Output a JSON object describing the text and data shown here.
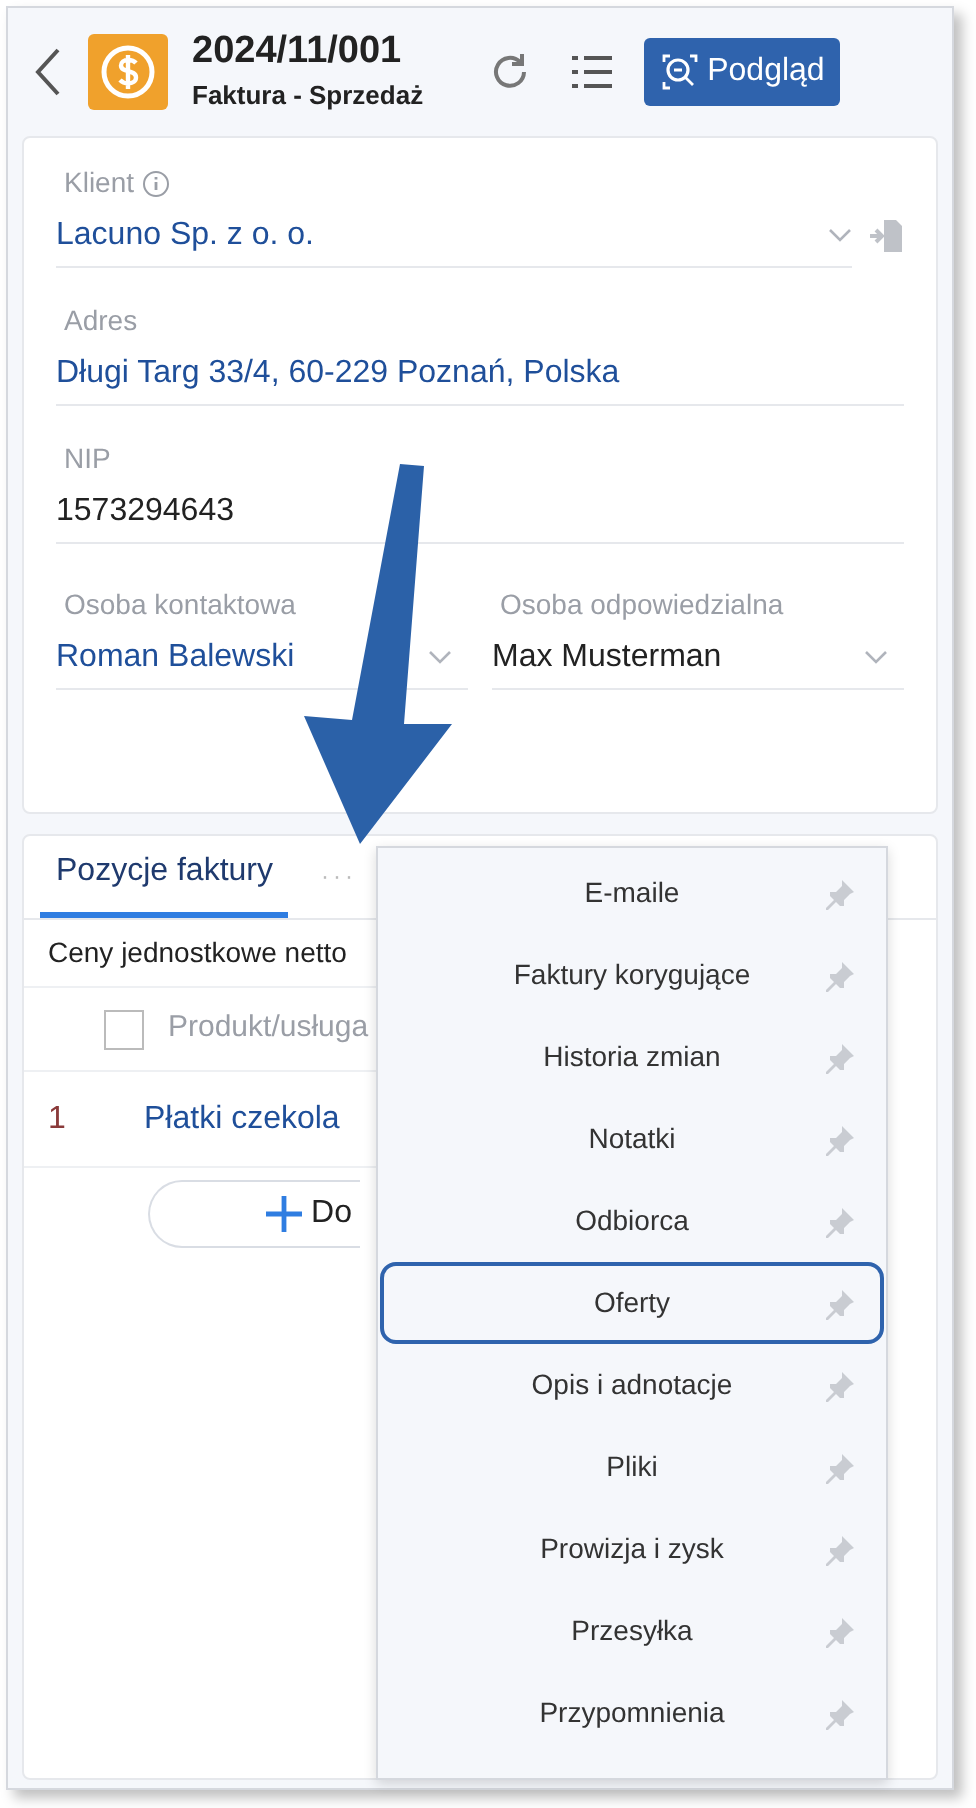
{
  "header": {
    "number": "2024/11/001",
    "subtitle": "Faktura - Sprzedaż",
    "preview_button": "Podgląd"
  },
  "fields": [
    {
      "kind": "select",
      "label": "Klient",
      "info": true,
      "value": "Lacuno Sp. z o. o.",
      "link": true
    },
    {
      "kind": "text",
      "label": "Adres",
      "value": "Długi Targ 33/4, 60-229 Poznań, Polska",
      "link": true
    },
    {
      "kind": "text",
      "label": "NIP",
      "value": "1573294643",
      "link": false
    }
  ],
  "people": [
    {
      "label": "Osoba kontaktowa",
      "value": "Roman Balewski",
      "link": true
    },
    {
      "label": "Osoba odpowiedzialna",
      "value": "Max Musterman",
      "link": false
    }
  ],
  "tabs": [
    {
      "label": "Pozycje faktury",
      "selected": true
    }
  ],
  "more_tabs": "···",
  "price_mode": "Ceny jednostkowe netto",
  "table": {
    "column": "Produkt/usługa",
    "checked": false,
    "rows": [
      {
        "index": "1",
        "product": "Płatki czekola"
      }
    ]
  },
  "add_button": "Do",
  "menu": [
    {
      "label": "E-maile",
      "selected": false
    },
    {
      "label": "Faktury korygujące",
      "selected": false
    },
    {
      "label": "Historia zmian",
      "selected": false
    },
    {
      "label": "Notatki",
      "selected": false
    },
    {
      "label": "Odbiorca",
      "selected": false
    },
    {
      "label": "Oferty",
      "selected": true
    },
    {
      "label": "Opis i adnotacje",
      "selected": false
    },
    {
      "label": "Pliki",
      "selected": false
    },
    {
      "label": "Prowizja i zysk",
      "selected": false
    },
    {
      "label": "Przesyłka",
      "selected": false
    },
    {
      "label": "Przypomnienia",
      "selected": false
    }
  ]
}
